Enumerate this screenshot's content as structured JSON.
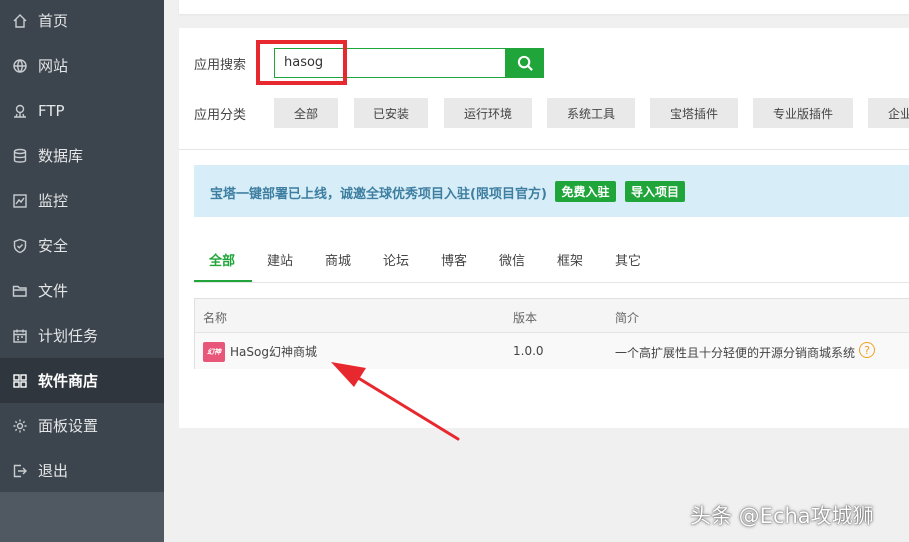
{
  "sidebar": {
    "items": [
      {
        "label": "首页",
        "icon": "home-icon"
      },
      {
        "label": "网站",
        "icon": "globe-icon"
      },
      {
        "label": "FTP",
        "icon": "ftp-icon"
      },
      {
        "label": "数据库",
        "icon": "database-icon"
      },
      {
        "label": "监控",
        "icon": "monitor-icon"
      },
      {
        "label": "安全",
        "icon": "shield-icon"
      },
      {
        "label": "文件",
        "icon": "folder-icon"
      },
      {
        "label": "计划任务",
        "icon": "calendar-icon"
      },
      {
        "label": "软件商店",
        "icon": "grid-icon",
        "active": true
      },
      {
        "label": "面板设置",
        "icon": "gear-icon"
      },
      {
        "label": "退出",
        "icon": "logout-icon"
      }
    ]
  },
  "search": {
    "label": "应用搜索",
    "value": "hasog",
    "button_icon": "search-icon"
  },
  "category": {
    "label": "应用分类",
    "buttons": [
      "全部",
      "已安装",
      "运行环境",
      "系统工具",
      "宝塔插件",
      "专业版插件",
      "企业"
    ]
  },
  "notice": {
    "text": "宝塔一键部署已上线，诚邀全球优秀项目入驻(限项目官方)",
    "free_join": "免费入驻",
    "import": "导入项目"
  },
  "tabs": [
    "全部",
    "建站",
    "商城",
    "论坛",
    "博客",
    "微信",
    "框架",
    "其它"
  ],
  "table": {
    "headers": [
      "名称",
      "版本",
      "简介"
    ],
    "rows": [
      {
        "logo_text": "幻神",
        "name": "HaSog幻神商城",
        "version": "1.0.0",
        "desc": "一个高扩展性且十分轻便的开源分销商城系统",
        "help": "?"
      }
    ]
  },
  "colors": {
    "accent": "#20a53a",
    "sidebar_bg": "#3c444d",
    "highlight": "#e8282f"
  },
  "watermark": "头条 @Echa攻城狮"
}
